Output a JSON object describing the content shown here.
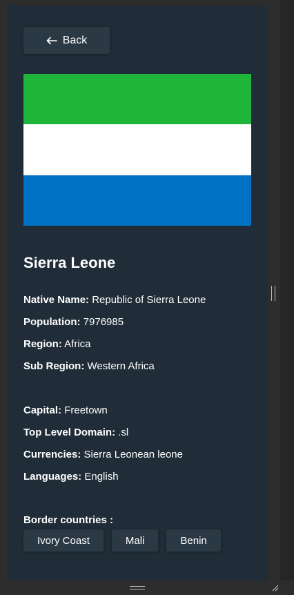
{
  "back_button": {
    "label": "Back",
    "icon": "arrow-left-icon"
  },
  "flag": {
    "description_icon": "sierra-leone-flag",
    "colors": [
      "#1eb53a",
      "#ffffff",
      "#0072c6"
    ]
  },
  "country": {
    "name": "Sierra Leone",
    "native_name": {
      "label": "Native Name:",
      "value": "Republic of Sierra Leone"
    },
    "population": {
      "label": "Population:",
      "value": "7976985"
    },
    "region": {
      "label": "Region:",
      "value": "Africa"
    },
    "sub_region": {
      "label": "Sub Region:",
      "value": "Western Africa"
    },
    "capital": {
      "label": "Capital:",
      "value": "Freetown"
    },
    "tld": {
      "label": "Top Level Domain:",
      "value": ".sl"
    },
    "currencies": {
      "label": "Currencies:",
      "value": "Sierra Leonean leone"
    },
    "languages": {
      "label": "Languages:",
      "value": "English"
    }
  },
  "borders": {
    "title": "Border countries :",
    "items": [
      "Ivory Coast",
      "Mali",
      "Benin"
    ]
  },
  "colors": {
    "background": "#202c37",
    "element": "#2b3945",
    "text": "#ffffff"
  }
}
